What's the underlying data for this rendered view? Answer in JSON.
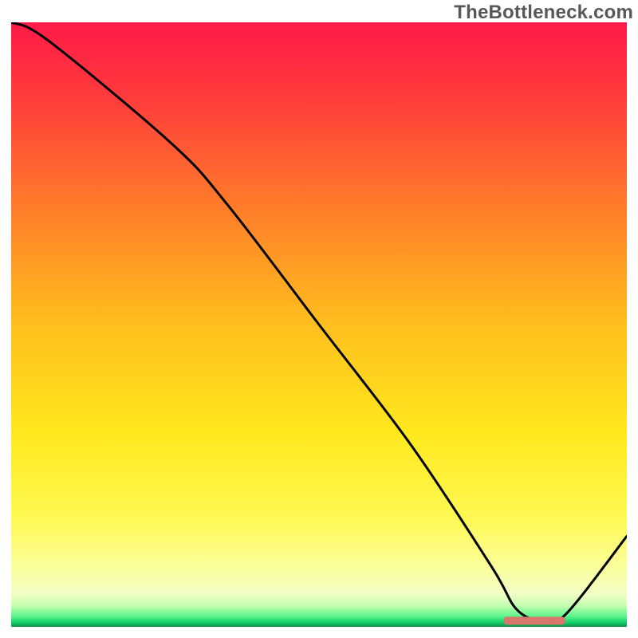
{
  "watermark": "TheBottleneck.com",
  "chart_data": {
    "type": "line",
    "title": "",
    "xlabel": "",
    "ylabel": "",
    "xlim": [
      0,
      100
    ],
    "ylim": [
      0,
      100
    ],
    "grid": false,
    "legend": false,
    "x": [
      0,
      6,
      26,
      35,
      50,
      65,
      78,
      82,
      86,
      90,
      100
    ],
    "values": [
      100,
      97,
      80,
      70,
      50,
      30,
      10,
      3,
      1,
      2,
      15
    ],
    "marker": {
      "x_start": 80,
      "x_end": 90,
      "y": 1,
      "color": "#d9776d"
    },
    "background_gradient": {
      "stops": [
        {
          "offset": 0.0,
          "color": "#ff1a48"
        },
        {
          "offset": 0.12,
          "color": "#ff3a3c"
        },
        {
          "offset": 0.3,
          "color": "#ff7a2a"
        },
        {
          "offset": 0.5,
          "color": "#ffbf1e"
        },
        {
          "offset": 0.68,
          "color": "#ffe81e"
        },
        {
          "offset": 0.82,
          "color": "#fef953"
        },
        {
          "offset": 0.9,
          "color": "#fbff9a"
        },
        {
          "offset": 0.945,
          "color": "#f2ffc6"
        },
        {
          "offset": 0.965,
          "color": "#c3ffb0"
        },
        {
          "offset": 0.982,
          "color": "#5ff58d"
        },
        {
          "offset": 0.992,
          "color": "#16d66e"
        },
        {
          "offset": 1.0,
          "color": "#0f8f4c"
        }
      ]
    },
    "line_color": "#000000",
    "line_width": 3
  }
}
